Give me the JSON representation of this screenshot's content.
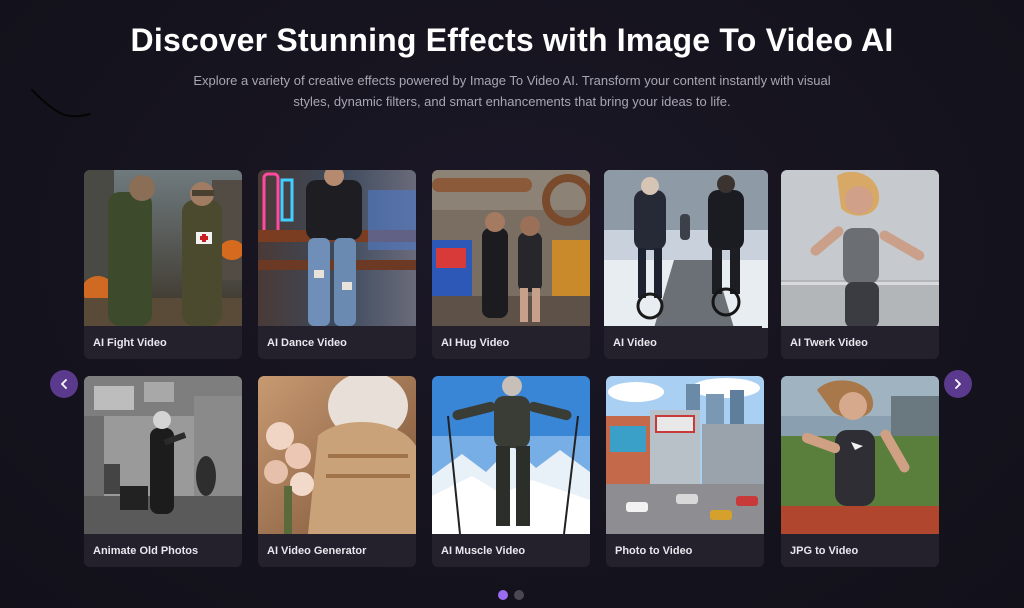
{
  "header": {
    "title": "Discover Stunning Effects with Image To Video AI",
    "subtitle": "Explore a variety of creative effects powered by Image To Video AI. Transform your content instantly with visual styles, dynamic filters, and smart enhancements that bring your ideas to life."
  },
  "cards": [
    {
      "label": "AI Fight Video"
    },
    {
      "label": "AI Dance Video"
    },
    {
      "label": "AI Hug Video"
    },
    {
      "label": "AI Video"
    },
    {
      "label": "AI Twerk Video"
    },
    {
      "label": "Animate Old Photos"
    },
    {
      "label": "AI Video Generator"
    },
    {
      "label": "AI Muscle Video"
    },
    {
      "label": "Photo to Video"
    },
    {
      "label": "JPG to Video"
    }
  ],
  "carousel": {
    "prev_icon": "chevron-left-icon",
    "next_icon": "chevron-right-icon",
    "pages": 2,
    "active_page": 1
  },
  "colors": {
    "accent": "#9b6cf0",
    "nav_button": "#5b3a8e",
    "card_bg": "#24212c",
    "page_bg": "#15131d"
  }
}
